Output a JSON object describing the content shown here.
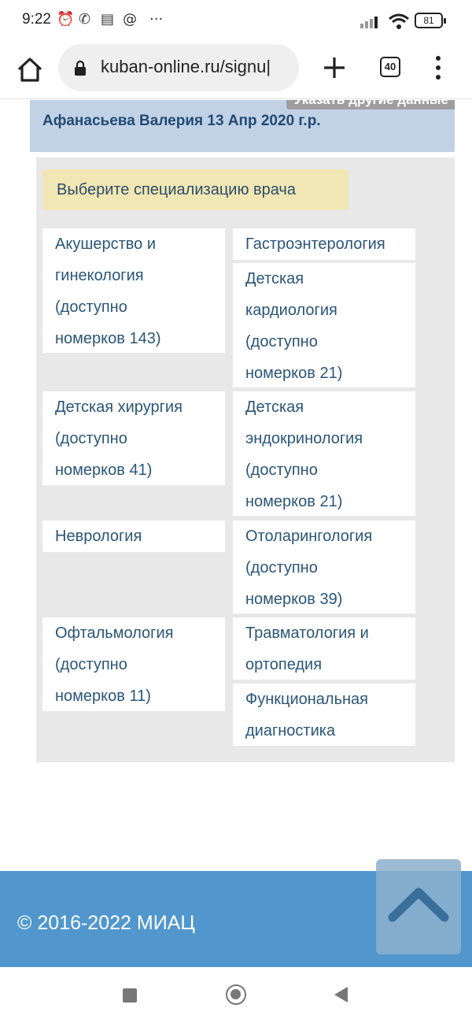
{
  "status_bar": {
    "time": "9:22",
    "notification_icons": [
      "alarm-icon",
      "whatsapp-icon",
      "news-icon",
      "at-icon",
      "more-dots"
    ],
    "more_text": "···",
    "battery": "81"
  },
  "browser": {
    "url": "kuban-online.ru/signu|",
    "tab_count": "40"
  },
  "patient": {
    "name": "Афанасьева Валерия 13 Апр 2020 г.р.",
    "other_data_button": "Указать другие данные"
  },
  "specialization": {
    "title": "Выберите специализацию врача",
    "items": [
      {
        "lines": [
          "Акушерство и",
          "гинекология",
          "(доступно",
          "номерков 143)"
        ]
      },
      {
        "lines": [
          "Гастроэнтерология"
        ]
      },
      {
        "lines": [
          "Детская",
          "кардиология",
          "(доступно",
          "номерков 21)"
        ]
      },
      {
        "lines": [
          "Детская хирургия",
          "(доступно",
          "номерков 41)"
        ]
      },
      {
        "lines": [
          "Детская",
          "эндокринология",
          "(доступно",
          "номерков 21)"
        ]
      },
      {
        "lines": [
          "Неврология"
        ]
      },
      {
        "lines": [
          "Отоларингология",
          "(доступно",
          "номерков 39)"
        ]
      },
      {
        "lines": [
          "Офтальмология",
          "(доступно",
          "номерков 11)"
        ]
      },
      {
        "lines": [
          "Травматология и",
          "ортопедия"
        ]
      },
      {
        "lines": [
          "Функциональная",
          "диагностика"
        ]
      }
    ]
  },
  "footer": {
    "copyright": "© 2016-2022 МИАЦ"
  },
  "colors": {
    "patient_panel": "#c1d2e6",
    "title_bg": "#f1e7b5",
    "link": "#2a5678",
    "footer": "#5197cd"
  }
}
